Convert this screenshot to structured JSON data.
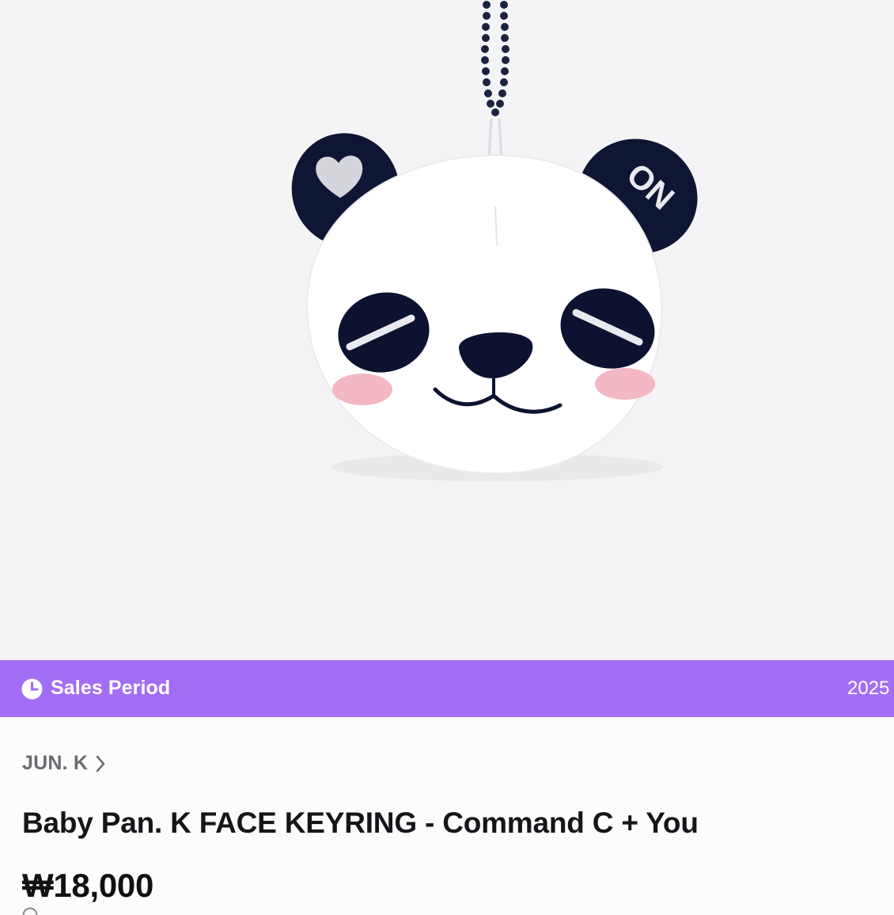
{
  "hero": {
    "image_alt": "Baby Pan. K face keyring panda plush",
    "left_ear_symbol": "heart",
    "right_ear_text": "ON"
  },
  "sales_period": {
    "label": "Sales Period",
    "date": "2025",
    "icon": "clock-icon",
    "background": "#a16ef5"
  },
  "product": {
    "artist": "JUN. K",
    "title": "Baby Pan. K FACE KEYRING - Command C + You",
    "price": "₩18,000"
  }
}
